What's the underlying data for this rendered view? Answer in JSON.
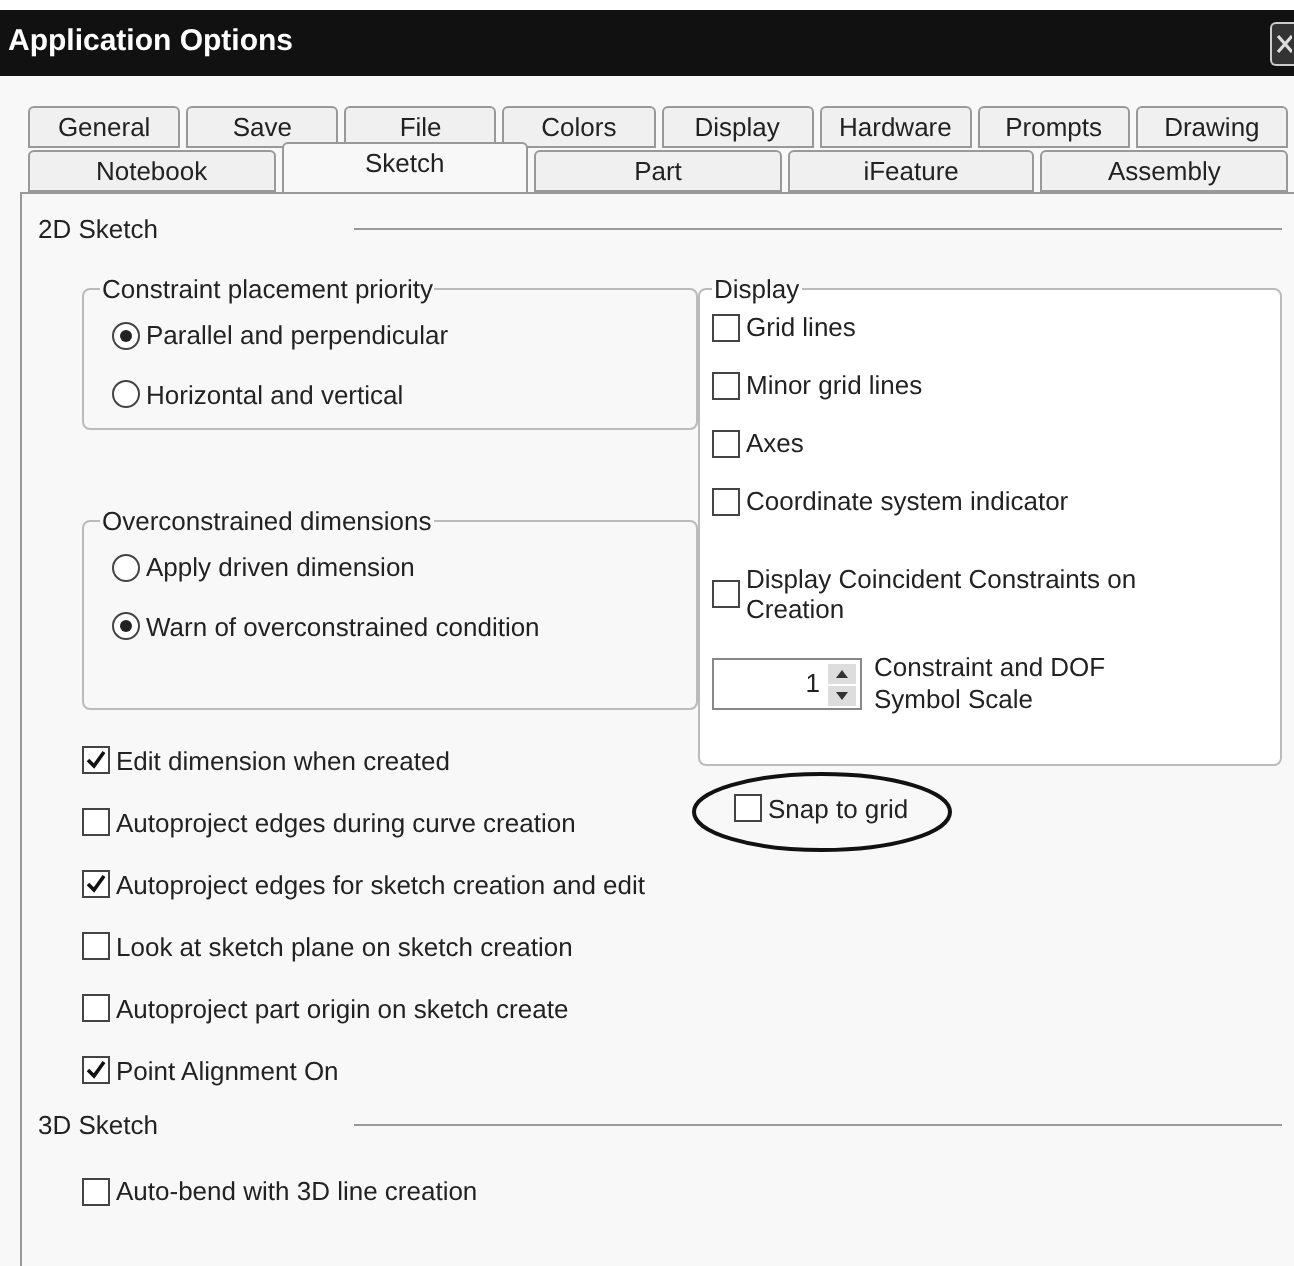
{
  "window": {
    "title": "Application Options"
  },
  "tab_rows": [
    {
      "tabs": [
        {
          "label": "General",
          "selected": false
        },
        {
          "label": "Save",
          "selected": false
        },
        {
          "label": "File",
          "selected": false
        },
        {
          "label": "Colors",
          "selected": false
        },
        {
          "label": "Display",
          "selected": false
        },
        {
          "label": "Hardware",
          "selected": false
        },
        {
          "label": "Prompts",
          "selected": false
        },
        {
          "label": "Drawing",
          "selected": false
        }
      ]
    },
    {
      "tabs": [
        {
          "label": "Notebook",
          "selected": false
        },
        {
          "label": "Sketch",
          "selected": true
        },
        {
          "label": "Part",
          "selected": false
        },
        {
          "label": "iFeature",
          "selected": false
        },
        {
          "label": "Assembly",
          "selected": false
        }
      ]
    }
  ],
  "sketch_2d": {
    "title": "2D Sketch",
    "constraint_placement": {
      "title": "Constraint placement priority",
      "options": [
        {
          "label": "Parallel and perpendicular",
          "selected": true
        },
        {
          "label": "Horizontal and vertical",
          "selected": false
        }
      ]
    },
    "overconstrained": {
      "title": "Overconstrained dimensions",
      "options": [
        {
          "label": "Apply driven dimension",
          "selected": false
        },
        {
          "label": "Warn of overconstrained condition",
          "selected": true
        }
      ]
    },
    "checkboxes": [
      {
        "label": "Edit dimension when created",
        "checked": true
      },
      {
        "label": "Autoproject edges during curve creation",
        "checked": false
      },
      {
        "label": "Autoproject edges for sketch creation and edit",
        "checked": true
      },
      {
        "label": "Look at sketch plane on sketch creation",
        "checked": false
      },
      {
        "label": "Autoproject part origin on sketch create",
        "checked": false
      },
      {
        "label": "Point Alignment On",
        "checked": true
      }
    ],
    "display": {
      "title": "Display",
      "checkboxes": [
        {
          "label": "Grid lines",
          "checked": false
        },
        {
          "label": "Minor grid lines",
          "checked": false
        },
        {
          "label": "Axes",
          "checked": false
        },
        {
          "label": "Coordinate system indicator",
          "checked": false
        },
        {
          "label": "Display Coincident Constraints on Creation",
          "checked": false
        }
      ],
      "symbol_scale": {
        "value": "1",
        "label": "Constraint and DOF Symbol Scale"
      }
    },
    "snap_to_grid": {
      "label": "Snap to grid",
      "checked": false
    }
  },
  "sketch_3d": {
    "title": "3D Sketch",
    "checkboxes": [
      {
        "label": "Auto-bend with 3D line creation",
        "checked": false
      }
    ]
  }
}
